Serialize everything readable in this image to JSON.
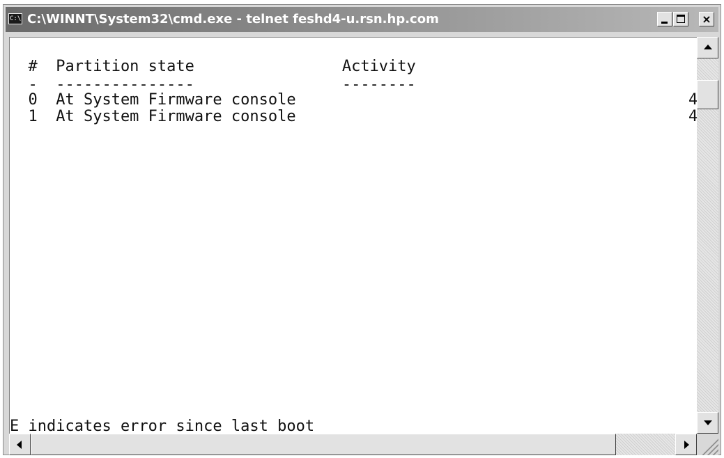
{
  "window": {
    "title": "C:\\WINNT\\System32\\cmd.exe - telnet feshd4-u.rsn.hp.com",
    "icon": "C:\\",
    "controls": {
      "minimize": "minimize-icon",
      "maximize": "maximize-icon",
      "close": "×"
    }
  },
  "console": {
    "lines": [
      "  #  Partition state                Activity",
      "  -  ---------------                --------",
      "  0  At System Firmware console",
      "  1  At System Firmware console",
      "E indicates error since last boot"
    ],
    "right_edge_values": [
      "4",
      "4"
    ]
  },
  "colors": {
    "titlebar_left": "#6a6a6a",
    "titlebar_right": "#b8b8b8",
    "console_bg": "#ffffff",
    "console_text": "#111111"
  }
}
